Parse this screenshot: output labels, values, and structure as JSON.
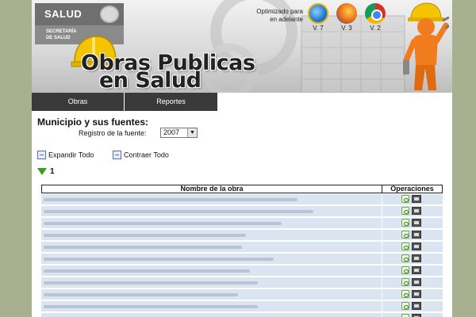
{
  "header": {
    "logo": {
      "main": "SALUD",
      "line1": "SECRETARÍA",
      "line2": "DE SALUD"
    },
    "title_line1": "Obras Publicas",
    "title_line2": "en Salud",
    "optimized_text": "Optimizado para en adelante",
    "browsers": [
      {
        "icon": "internet-explorer-icon",
        "version": "V. 7"
      },
      {
        "icon": "firefox-icon",
        "version": "V. 3"
      },
      {
        "icon": "chrome-icon",
        "version": "V. 2"
      }
    ]
  },
  "nav": {
    "items": [
      {
        "label": "Obras"
      },
      {
        "label": "Reportes"
      }
    ]
  },
  "main": {
    "section_title": "Municipio y sus fuentes:",
    "registro_label": "Registro de la fuente:",
    "year_value": "2007",
    "expand_label": "Expandir Todo",
    "collapse_label": "Contraer Todo",
    "level_label": "1",
    "table": {
      "columns": [
        "Nombre de la obra",
        "Operaciones"
      ],
      "row_count": 11
    }
  },
  "colors": {
    "background": "#a9b090",
    "nav": "#3a3a3a",
    "row": "#dbe5f1",
    "accent_green": "#3aa01c"
  }
}
